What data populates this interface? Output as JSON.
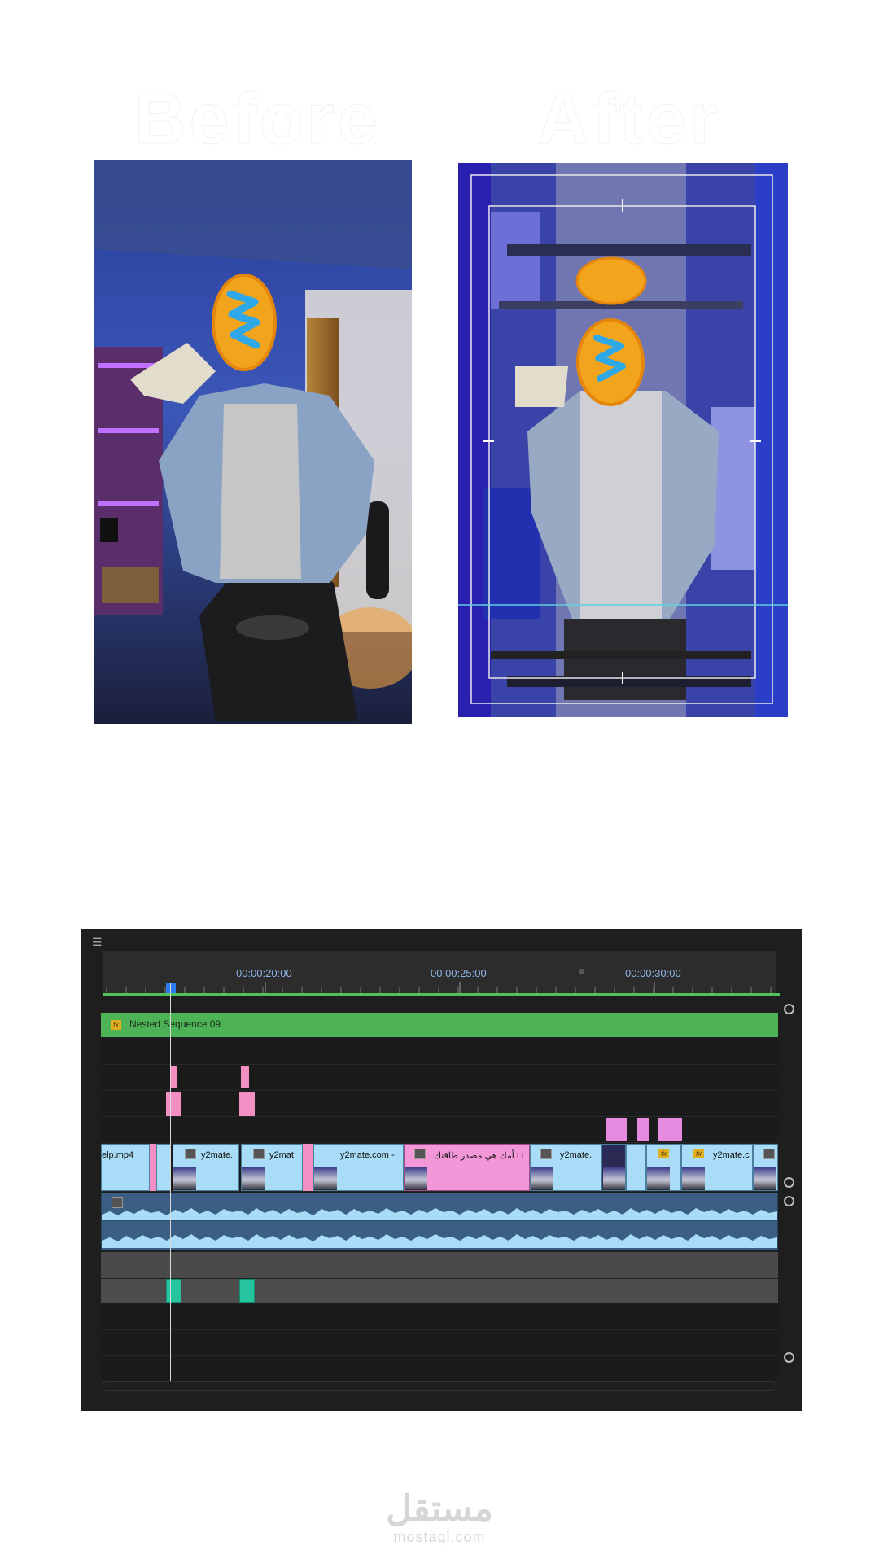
{
  "titles": {
    "before": "Before",
    "after": "After"
  },
  "timeline": {
    "menu_icon": "hamburger-icon",
    "timecodes": [
      "00:00:20:00",
      "00:00:25:00",
      "00:00:30:00"
    ],
    "nested_sequence": {
      "fx": "fx",
      "label": "Nested Sequence 09"
    },
    "clips": [
      {
        "label": "elp.mp4"
      },
      {
        "label": "y2mate."
      },
      {
        "label": "y2mat"
      },
      {
        "label": "y2mate.com -"
      },
      {
        "label": "أمك هي مصدر طاقتك  Li"
      },
      {
        "label": "y2mate."
      },
      {
        "label": "y2mate.c"
      }
    ],
    "colors": {
      "nested": "#4db356",
      "video_clip": "#a9dcf6",
      "adjustment_clip": "#f48fc3",
      "audio_clip": "#3b5f84",
      "audio_short": "#27c4a0",
      "playhead": "#2e7bf0"
    }
  },
  "watermark": {
    "arabic": "مستقل",
    "latin": "mostaql.com"
  }
}
